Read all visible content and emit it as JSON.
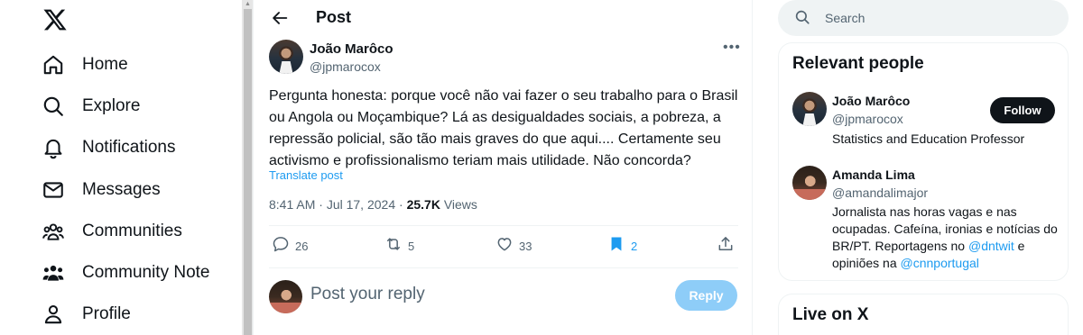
{
  "nav": {
    "items": [
      {
        "label": "Home",
        "icon": "home-icon"
      },
      {
        "label": "Explore",
        "icon": "search-icon"
      },
      {
        "label": "Notifications",
        "icon": "bell-icon"
      },
      {
        "label": "Messages",
        "icon": "envelope-icon"
      },
      {
        "label": "Communities",
        "icon": "communities-icon"
      },
      {
        "label": "Community Note",
        "icon": "community-notes-icon"
      },
      {
        "label": "Profile",
        "icon": "person-icon"
      }
    ]
  },
  "post": {
    "header_title": "Post",
    "author_name": "João Marôco",
    "author_handle": "@jpmarocox",
    "text": "Pergunta honesta: porque você não vai fazer o seu trabalho para o Brasil ou Angola ou Moçambique? Lá as desigualdades sociais, a pobreza, a repressão policial, são tão mais graves do que aqui.... Certamente seu activismo e profissionalismo teriam mais utilidade. Não concorda?",
    "translate_label": "Translate post",
    "time": "8:41 AM",
    "date": "Jul 17, 2024",
    "views_count": "25.7K",
    "views_label": "Views",
    "replies": "26",
    "reposts": "5",
    "likes": "33",
    "bookmarks": "2"
  },
  "reply": {
    "placeholder": "Post your reply",
    "button_label": "Reply"
  },
  "search": {
    "placeholder": "Search"
  },
  "relevant": {
    "title": "Relevant people",
    "people": [
      {
        "name": "João Marôco",
        "handle": "@jpmarocox",
        "bio": "Statistics and Education Professor",
        "follow_label": "Follow"
      },
      {
        "name": "Amanda Lima",
        "handle": "@amandalimajor",
        "bio_part1": "Jornalista nas horas vagas e nas ocupadas. Cafeína, ironias e notícias do BR/PT. Reportagens no ",
        "mention1": "@dntwit",
        "bio_part2": " e opiniões na ",
        "mention2": "@cnnportugal"
      }
    ]
  },
  "live": {
    "title": "Live on X"
  },
  "colors": {
    "accent": "#1d9bf0",
    "text": "#0f1419",
    "secondary": "#536471"
  }
}
